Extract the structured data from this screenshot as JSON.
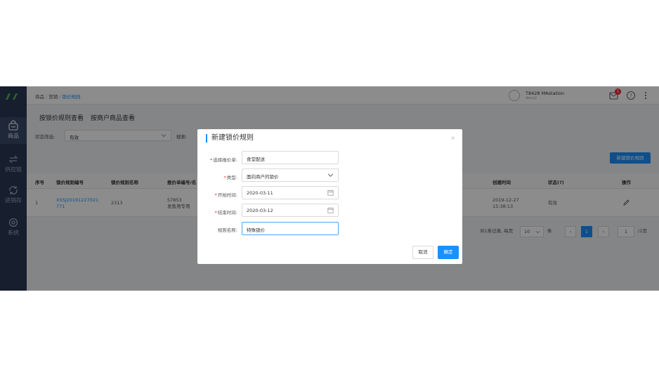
{
  "sidebar": {
    "items": [
      {
        "label": "商品",
        "icon": "shopping-bag-icon"
      },
      {
        "label": "供应链",
        "icon": "exchange-icon"
      },
      {
        "label": "进销存",
        "icon": "cycle-icon"
      },
      {
        "label": "系统",
        "icon": "gear-icon"
      }
    ]
  },
  "breadcrumb": {
    "item1": "商品",
    "item2": "营销",
    "current": "锁价规则"
  },
  "user": {
    "name": "T8428 MAstation",
    "sub": "dzcx2"
  },
  "notifications": {
    "count": "5"
  },
  "tabs": [
    "按锁价规则查看",
    "按商户商品查看"
  ],
  "filter": {
    "status_label": "状态筛选:",
    "status_value": "有效",
    "search_label": "搜索:"
  },
  "new_button": "新建锁价规则",
  "table": {
    "headers": [
      "序号",
      "锁价规则编号",
      "锁价规则名称",
      "报价单编号/名",
      "创建时间",
      "状态(?)",
      "操作"
    ],
    "row": {
      "index": "1",
      "code_line1": "XSSJ20191227021",
      "code_line2": "771",
      "name": "2313",
      "quote_line1": "S7853",
      "quote_line2": "发售用专用",
      "created_line1": "2019-12-27",
      "created_line2": "15:38:13",
      "status": "有效"
    }
  },
  "pager": {
    "summary": "共1条记录, 每页",
    "page_size": "10",
    "unit": "条",
    "current_page": "1",
    "goto": "1",
    "total": "/1页"
  },
  "modal": {
    "title": "新建锁价规则",
    "fields": [
      {
        "label": "选择报价单:",
        "required": true,
        "value": "食堂配送"
      },
      {
        "label": "类型:",
        "required": true,
        "value": "面向商户的锁价"
      },
      {
        "label": "开始时间:",
        "required": true,
        "value": "2020-03-11"
      },
      {
        "label": "结束时间:",
        "required": true,
        "value": "2020-03-12"
      },
      {
        "label": "规则名称:",
        "required": false,
        "value": "特殊锁价"
      }
    ],
    "cancel": "取消",
    "ok": "确定"
  },
  "colors": {
    "primary": "#1890ff",
    "sidebar": "#2b3a55",
    "required": "#f5222d"
  }
}
